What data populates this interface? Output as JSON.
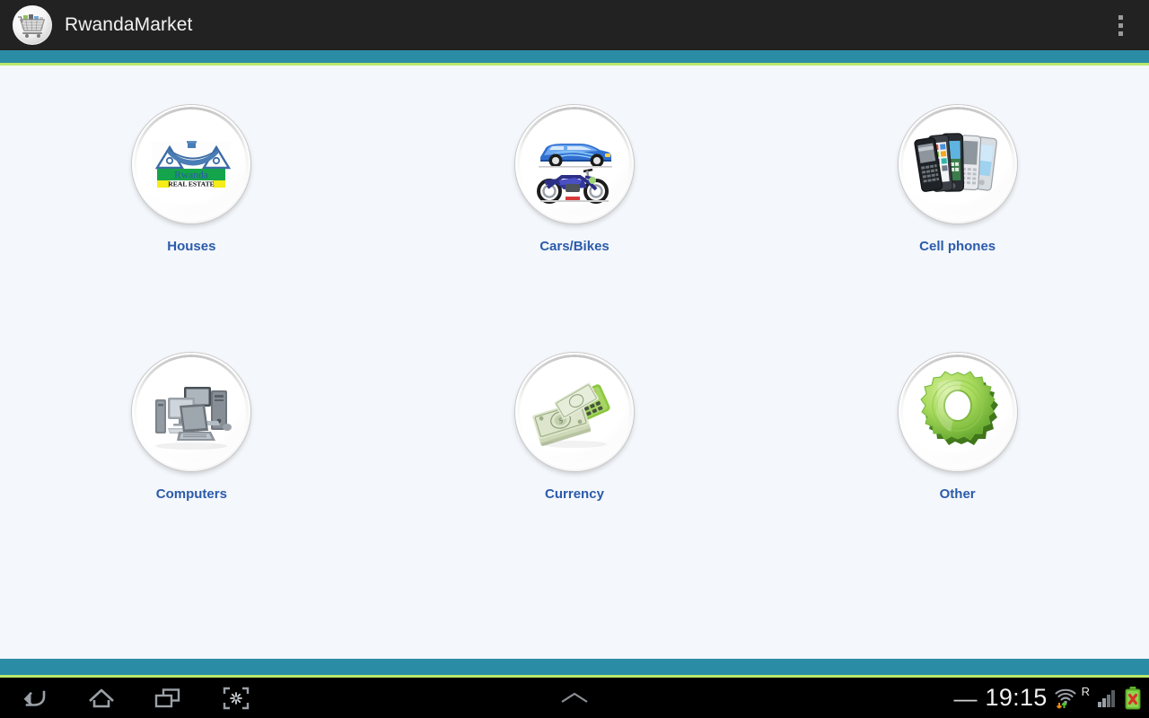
{
  "app": {
    "title": "RwandaMarket",
    "logo_icon": "shopping-cart-icon",
    "overflow_icon": "overflow-menu-icon",
    "background_color": "#f4f7fb",
    "titlebar_color": "#222222",
    "accent_teal": "#2b8ca6",
    "accent_green": "#b9e86a",
    "label_color": "#2b5bab"
  },
  "categories": [
    {
      "label": "Houses",
      "icon": "house-real-estate-icon",
      "logo_title": "Rwanda",
      "logo_subtitle": "REAL ESTATE"
    },
    {
      "label": "Cars/Bikes",
      "icon": "car-motorcycle-icon"
    },
    {
      "label": "Cell phones",
      "icon": "cell-phones-icon"
    },
    {
      "label": "Computers",
      "icon": "computers-icon"
    },
    {
      "label": "Currency",
      "icon": "banknotes-calculator-icon"
    },
    {
      "label": "Other",
      "icon": "gear-icon"
    }
  ],
  "navbar": {
    "back_label": "Back",
    "home_label": "Home",
    "recents_label": "Recent apps",
    "screenshot_label": "Screenshot",
    "expand_label": "Expand",
    "back_icon": "back-arrow-icon",
    "home_icon": "home-icon",
    "recents_icon": "recent-apps-icon",
    "screenshot_icon": "screenshot-icon",
    "expand_icon": "chevron-up-icon"
  },
  "status": {
    "dash": "—",
    "clock": "19:15",
    "roaming": "R",
    "wifi_icon": "wifi-data-icon",
    "signal_icon": "signal-bars-icon",
    "battery_icon": "battery-error-icon"
  }
}
